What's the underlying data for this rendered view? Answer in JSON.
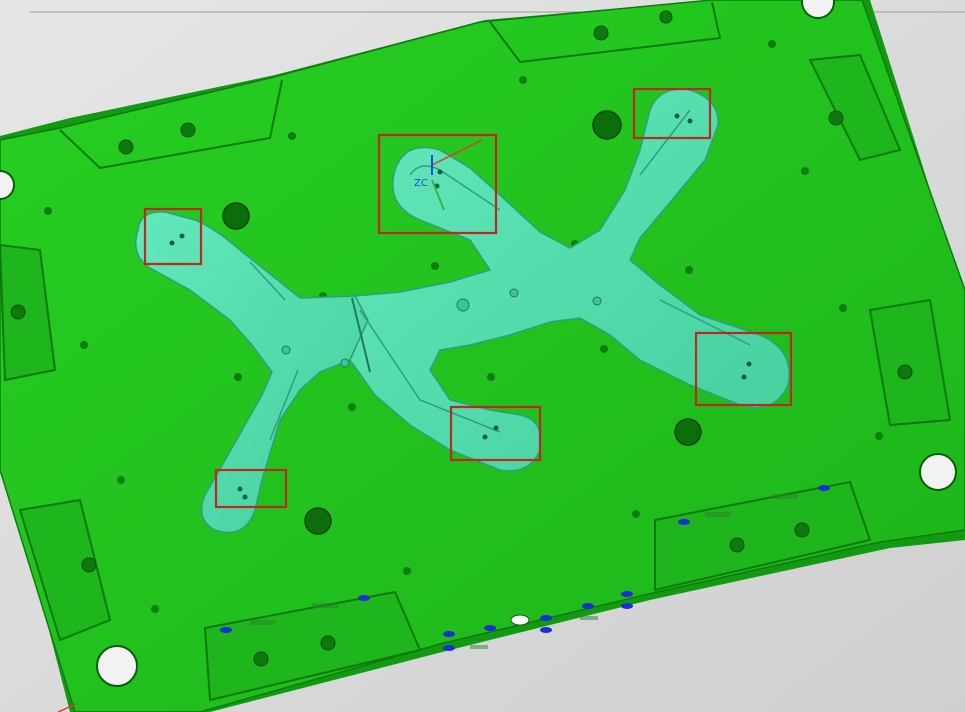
{
  "viewport": {
    "background": "#d9d9d9",
    "plate_color": "#22c21f",
    "plate_shadow_color": "#129b12",
    "insert_color": "#55dfae",
    "insert_edge_color": "#2e9f7c",
    "highlight_box_color": "#c0271f",
    "cooling_marker_color": "#1a2fd6"
  },
  "csys": {
    "label": "ZC",
    "x_axis_color": "#e23b2b",
    "z_axis_color": "#1a4fd6",
    "y_axis_color": "#3cb34a"
  },
  "highlight_boxes": [
    {
      "name": "highlight-box-top-center"
    },
    {
      "name": "highlight-box-top-right"
    },
    {
      "name": "highlight-box-left"
    },
    {
      "name": "highlight-box-right"
    },
    {
      "name": "highlight-box-bottom-center"
    },
    {
      "name": "highlight-box-bottom-left"
    }
  ]
}
